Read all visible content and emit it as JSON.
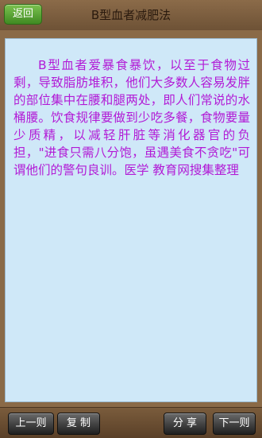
{
  "header": {
    "back_label": "返回",
    "title": "B型血者减肥法"
  },
  "article": {
    "text": "B型血者爱暴食暴饮，以至于食物过剩，导致脂肪堆积，他们大多数人容易发胖的部位集中在腰和腿两处，即人们常说的水桶腰。饮食规律要做到少吃多餐，食物要量少质精，以减轻肝脏等消化器官的负担，\"进食只需八分饱，虽遇美食不贪吃\"可谓他们的警句良训。医学 教育网搜集整理"
  },
  "footer": {
    "prev_label": "上一则",
    "copy_label": "复 制",
    "share_label": "分 享",
    "next_label": "下一则"
  },
  "colors": {
    "text": "#b21bd6",
    "panel": "#cfe8f8",
    "frame": "#8a6a47"
  }
}
